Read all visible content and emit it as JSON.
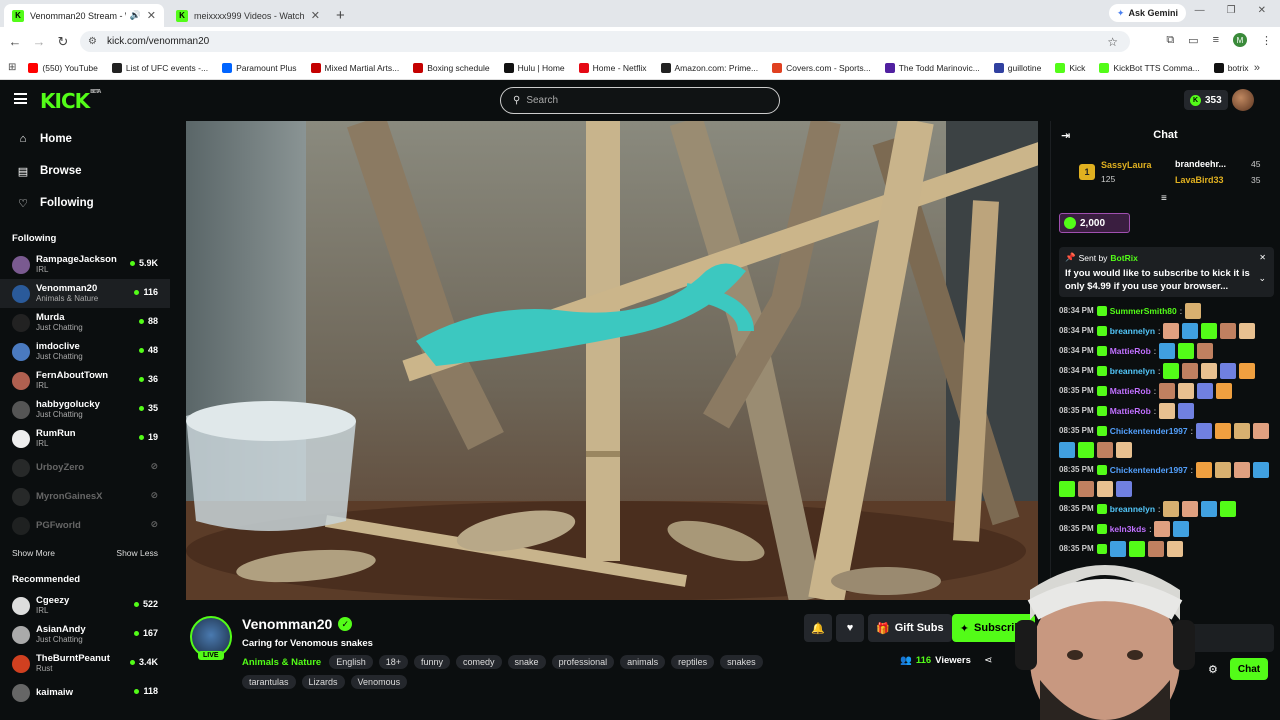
{
  "browser": {
    "tabs": [
      {
        "title": "Venomman20 Stream - Watch",
        "active": true
      },
      {
        "title": "meixxxx999 Videos - Watch On",
        "active": false
      }
    ],
    "ask_gemini": "Ask Gemini",
    "url": "kick.com/venomman20",
    "profile_initial": "M",
    "bookmarks": [
      {
        "label": "(550) YouTube",
        "color": "#ff0000"
      },
      {
        "label": "List of UFC events -...",
        "color": "#222222"
      },
      {
        "label": "Paramount Plus",
        "color": "#0064ff"
      },
      {
        "label": "Mixed Martial Arts...",
        "color": "#c40000"
      },
      {
        "label": "Boxing schedule",
        "color": "#c40000"
      },
      {
        "label": "Hulu | Home",
        "color": "#111111"
      },
      {
        "label": "Home - Netflix",
        "color": "#e50914"
      },
      {
        "label": "Amazon.com: Prime...",
        "color": "#222222"
      },
      {
        "label": "Covers.com - Sports...",
        "color": "#e04020"
      },
      {
        "label": "The Todd Marinovic...",
        "color": "#5020a0"
      },
      {
        "label": "guillotine",
        "color": "#3040a0"
      },
      {
        "label": "Kick",
        "color": "#53fc18"
      },
      {
        "label": "KickBot TTS Comma...",
        "color": "#53fc18"
      },
      {
        "label": "botrix",
        "color": "#111111"
      }
    ]
  },
  "header": {
    "logo": "KICK",
    "logo_sup": "BETA",
    "search_placeholder": "Search",
    "kicks_balance": "353"
  },
  "sidebar": {
    "nav": [
      {
        "label": "Home",
        "icon": "home-icon"
      },
      {
        "label": "Browse",
        "icon": "browse-icon"
      },
      {
        "label": "Following",
        "icon": "heart-icon"
      }
    ],
    "following_header": "Following",
    "following": [
      {
        "name": "RampageJackson",
        "category": "IRL",
        "viewers": "5.9K",
        "live": true,
        "color": "#7a5a90"
      },
      {
        "name": "Venomman20",
        "category": "Animals & Nature",
        "viewers": "116",
        "live": true,
        "color": "#2a5a9a",
        "selected": true
      },
      {
        "name": "Murda",
        "category": "Just Chatting",
        "viewers": "88",
        "live": true,
        "color": "#222222"
      },
      {
        "name": "imdoclive",
        "category": "Just Chatting",
        "viewers": "48",
        "live": true,
        "color": "#4a7ac0"
      },
      {
        "name": "FernAboutTown",
        "category": "IRL",
        "viewers": "36",
        "live": true,
        "color": "#b06050"
      },
      {
        "name": "habbygolucky",
        "category": "Just Chatting",
        "viewers": "35",
        "live": true,
        "color": "#555555"
      },
      {
        "name": "RumRun",
        "category": "IRL",
        "viewers": "19",
        "live": true,
        "color": "#eeeeee"
      },
      {
        "name": "UrboyZero",
        "category": "",
        "viewers": "",
        "live": false,
        "color": "#444444"
      },
      {
        "name": "MyronGainesX",
        "category": "",
        "viewers": "",
        "live": false,
        "color": "#444444"
      },
      {
        "name": "PGFworld",
        "category": "",
        "viewers": "",
        "live": false,
        "color": "#333333"
      }
    ],
    "show_more": "Show More",
    "show_less": "Show Less",
    "recommended_header": "Recommended",
    "recommended": [
      {
        "name": "Cgeezy",
        "category": "IRL",
        "viewers": "522",
        "color": "#dddddd"
      },
      {
        "name": "AsianAndy",
        "category": "Just Chatting",
        "viewers": "167",
        "color": "#aaaaaa"
      },
      {
        "name": "TheBurntPeanut",
        "category": "Rust",
        "viewers": "3.4K",
        "color": "#d04020"
      },
      {
        "name": "kaimaiw",
        "category": "",
        "viewers": "118",
        "color": "#666666"
      }
    ]
  },
  "channel": {
    "name": "Venomman20",
    "live_label": "LIVE",
    "title": "Caring for Venomous snakes",
    "category": "Animals & Nature",
    "tags": [
      "English",
      "18+",
      "funny",
      "comedy",
      "snake",
      "professional",
      "animals",
      "reptiles",
      "snakes",
      "tarantulas",
      "Lizards",
      "Venomous"
    ],
    "gift_label": "Gift Subs",
    "subscribe_label": "Subscribe",
    "viewers": "116",
    "viewers_label": "Viewers"
  },
  "chat": {
    "title": "Chat",
    "leaderboard": [
      {
        "rank": "1",
        "name": "SassyLaura",
        "count": "125",
        "color": "#e0b020"
      },
      {
        "name": "brandeehr...",
        "count": "45",
        "color": "#ffffff"
      },
      {
        "name": "LavaBird33",
        "count": "35",
        "color": "#e0b020"
      }
    ],
    "pinned_amount": "2,000",
    "pinned": {
      "sent_by_label": "Sent by",
      "sender": "BotRix",
      "message": "If you would like to subscribe to kick it is only $4.99 if you use your browser..."
    },
    "messages": [
      {
        "time": "08:34 PM",
        "user": "SummerSmith80",
        "color": "#53fc18",
        "emotes": 1
      },
      {
        "time": "08:34 PM",
        "user": "breannelyn",
        "color": "#53c8fc",
        "emotes": 5
      },
      {
        "time": "08:34 PM",
        "user": "MattieRob",
        "color": "#c070ff",
        "emotes": 3
      },
      {
        "time": "08:34 PM",
        "user": "breannelyn",
        "color": "#53c8fc",
        "emotes": 5
      },
      {
        "time": "08:35 PM",
        "user": "MattieRob",
        "color": "#c070ff",
        "emotes": 4
      },
      {
        "time": "08:35 PM",
        "user": "MattieRob",
        "color": "#c070ff",
        "emotes": 2
      },
      {
        "time": "08:35 PM",
        "user": "Chickentender1997",
        "color": "#53a0fc",
        "emotes": 8
      },
      {
        "time": "08:35 PM",
        "user": "Chickentender1997",
        "color": "#53a0fc",
        "emotes": 8
      },
      {
        "time": "08:35 PM",
        "user": "breannelyn",
        "color": "#53c8fc",
        "emotes": 4
      },
      {
        "time": "08:35 PM",
        "user": "keln3kds",
        "color": "#c070ff",
        "emotes": 2
      },
      {
        "time": "08:35 PM",
        "user": "",
        "color": "#53fc18",
        "emotes": 4
      }
    ],
    "input_placeholder": "Send a message",
    "send_label": "Chat"
  }
}
